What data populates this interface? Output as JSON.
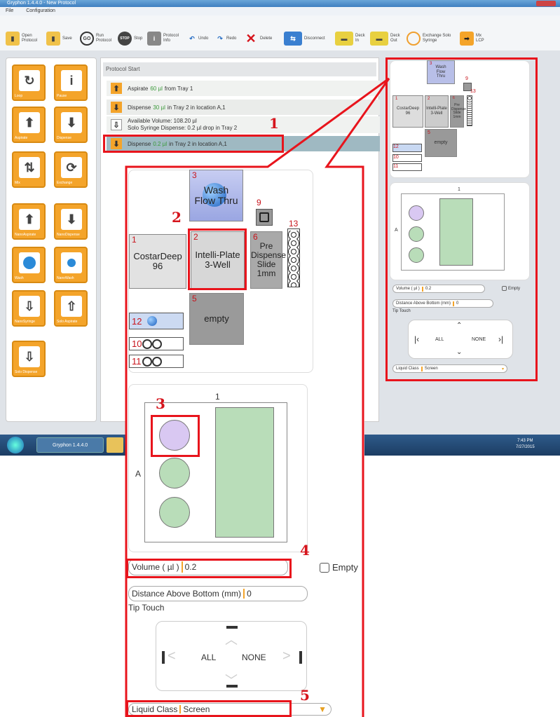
{
  "window": {
    "title": "Gryphon 1.4.4.0 - New Protocol"
  },
  "menu": {
    "file": "File",
    "configuration": "Configuration"
  },
  "toolbar": {
    "open": "Open Protocol",
    "save": "Save",
    "run": "Run Protocol",
    "stop": "Stop",
    "info": "Protocol Info",
    "undo": "Undo",
    "redo": "Redo",
    "delete": "Delete",
    "disconnect": "Disconnect",
    "deck_in": "Deck In",
    "deck_out": "Deck Out",
    "exchange": "Exchange Solo Syringe",
    "mx": "Mx LCP"
  },
  "palette": [
    "Loop",
    "Pause",
    "Aspirate",
    "Dispense",
    "Mix",
    "Exchange",
    "NanoAspirate",
    "NanoDispense",
    "Wash",
    "NanoWash",
    "NanoSyringe",
    "Solo Aspirate",
    "Solo Dispense"
  ],
  "protocol": {
    "header": "Protocol Start",
    "steps": [
      {
        "pre": "Aspirate",
        "vol": "60 µl",
        "post": "from Tray 1"
      },
      {
        "pre": "Dispense",
        "vol": "30 µl",
        "post": "in Tray 2 in location A,1"
      },
      {
        "line1": "Available Volume: 108.20 µl",
        "line2": "Solo Syringe Dispense: 0.2 µl  drop  in Tray 2"
      },
      {
        "pre": "Dispense",
        "vol": "0.2 µl",
        "post": "in Tray 2 in location A,1"
      }
    ]
  },
  "taskbar": {
    "app": "Gryphon 1.4.4.0",
    "time": "7:43 PM",
    "date": "7/27/2015"
  },
  "callouts": [
    "1",
    "2",
    "3",
    "4",
    "5"
  ],
  "deck": {
    "wash": {
      "num": "3",
      "label": "Wash Flow Thru"
    },
    "pos9": "9",
    "costar": {
      "num": "1",
      "label": "CostarDeep 96"
    },
    "intelli": {
      "num": "2",
      "label": "Intelli-Plate 3-Well"
    },
    "pre": {
      "num": "6",
      "label": "Pre Dispense Slide 1mm"
    },
    "pos13": "13",
    "empty": {
      "num": "5",
      "label": "empty"
    },
    "pos12": "12",
    "pos10": "10",
    "pos11": "11"
  },
  "well_map": {
    "column": "1",
    "row": "A"
  },
  "volume": {
    "label": "Volume ( µl )",
    "value": "0.2",
    "empty": "Empty"
  },
  "distance": {
    "label": "Distance Above Bottom (mm)",
    "value": "0"
  },
  "tip_touch": {
    "label": "Tip Touch",
    "all": "ALL",
    "none": "NONE"
  },
  "liquid": {
    "label": "Liquid Class",
    "value": "Screen"
  },
  "small_deck": {
    "wash": "3",
    "wash_label": "Wash Flow Thru",
    "pos9": "9",
    "pos13": "13",
    "costar": "1",
    "costar_label": "CostarDeep 96",
    "intelli": "2",
    "intelli_label": "Intelli-Plate 3-Well",
    "pre": "6",
    "pre_label": "Pre Dispense Slide 1mm",
    "empty": "5",
    "empty_label": "empty",
    "pos12": "12",
    "pos10": "10",
    "pos11": "11",
    "col": "1",
    "row": "A",
    "vol_label": "Volume ( µl )",
    "vol_value": "0.2",
    "vol_empty": "Empty",
    "dist_label": "Distance Above Bottom (mm)",
    "dist_value": "0",
    "tip": "Tip Touch",
    "all": "ALL",
    "none": "NONE",
    "liq_label": "Liquid Class",
    "liq_value": "Screen"
  },
  "colors": {
    "accent": "#f4a42a",
    "callout": "#e8141c",
    "well_green": "#b9ddb9",
    "well_selected": "#d9c8f2"
  }
}
